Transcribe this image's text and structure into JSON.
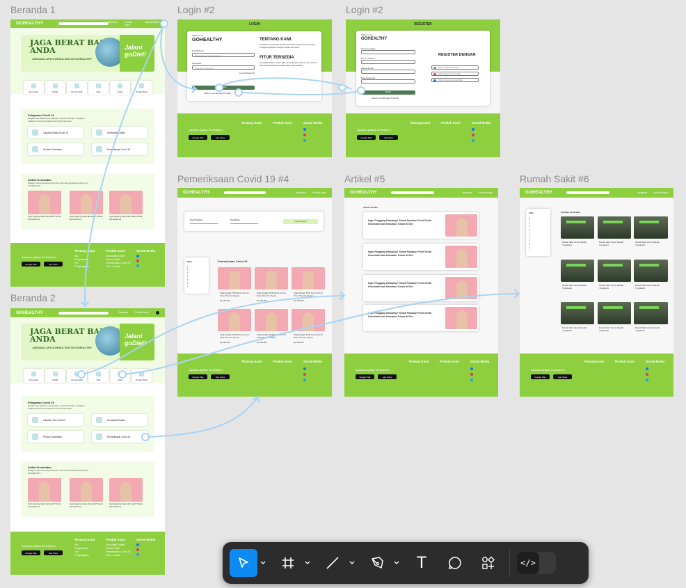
{
  "canvas": {
    "background": "#e5e5e5",
    "accent": "#8dcf3f",
    "selection": "#0d8bf2",
    "connector": "#a9d3f5"
  },
  "frames": {
    "beranda1": "Beranda 1",
    "beranda2": "Beranda 2",
    "login": "Login #2",
    "register": "Login #2",
    "covid": "Pemeriksaan Covid 19 #4",
    "artikel": "Artikel #5",
    "rumahsakit": "Rumah Sakit #6"
  },
  "nav": {
    "logo": "GOHEALTHY",
    "links": [
      "Beranda",
      "Kontak Kami",
      "Masuk/Daftar"
    ],
    "links2": [
      "Beranda",
      "Produk Kami"
    ]
  },
  "hero": {
    "title_line1": "JAGA BERAT BADAN",
    "title_line2": "ANDA",
    "subtitle": "JANGAN LUPA KONSULTASI DI GOHEALTHY",
    "cta_line1": "Jalani",
    "cta_line2": "goDiet!"
  },
  "categories": [
    "Konsultasi",
    "Mobile",
    "Rumah Sakit",
    "Toko",
    "Artikel",
    "Produk Medis"
  ],
  "covid_section": {
    "title": "Pelayanan Covid 19",
    "desc": "Jangan lupa lakukan pencegahan covid-19 dengan mengikuti kebijakan dari Kemenkes/pemerintah setempat.",
    "services": [
      "Lakukan Rapid Covid 19",
      "Konsultasi Dokter",
      "Produk Kesehatan",
      "Pemeriksaan Covid 19"
    ],
    "services2": [
      "Lakukan Tes Covid 19",
      "Konsultasi Dokter",
      "Produk Kesehatan",
      "Pemeriksaan Covid 19"
    ]
  },
  "articles": {
    "title": "Artikel Kesehatan",
    "desc": "Pelajari cara pola hidup sehat dan informasi kesehatan lainnya di GOHEALTHY.",
    "item": "Ingin langsing tanpa diet ketat? Simak tips berikut ini"
  },
  "footer": {
    "download": "Dapatkan Aplikasi GoHealthy di",
    "google_play": "Google Play",
    "app_store": "App Store",
    "col1_title": "Tentang Kami",
    "col1": [
      "Visi",
      "Pengalaman",
      "Tim",
      "Penghargaan"
    ],
    "col2_title": "Produk Kami",
    "col2": [
      "Konsultasi Dokter",
      "Rumah Sakit",
      "Pemeriksaan Covid-19",
      "Toko - Apotek"
    ],
    "col3_title": "Social Media",
    "col3": [
      "Facebook",
      "Instagram",
      "Twitter"
    ]
  },
  "login": {
    "header": "LOGIN",
    "welcome": "Welcome to",
    "brand": "GOHEALTHY",
    "email_label": "Email/Nomor",
    "email_placeholder": "Masukkan email atau nomor",
    "password_label": "Password",
    "password_placeholder": "Masukkan password",
    "forgot": "Lupa Password?",
    "button": "Masuk",
    "register_prompt": "Belum memiliki akun? Daftar",
    "about_title": "TENTANG KAMI",
    "about_text": "GoHealthy merupakan aplikasi kesehatan yang membantu Anda menjaga kesehatan dengan mudah dan cepat.",
    "features_title": "FITUR TERSEDIA",
    "features_text": "Konsultasi dokter, rumah sakit, pemeriksaan covid-19, toko apotek dan artikel kesehatan tersedia dalam satu aplikasi."
  },
  "register": {
    "header": "REGISTER",
    "welcome": "Welcome to",
    "brand": "GOHEALTHY",
    "fields": [
      "Nama Lengkap",
      "Nomor Telepon",
      "Alamat Email",
      "Buat Password"
    ],
    "button": "Daftar",
    "login_prompt": "Sudah memiliki akun? Masuk",
    "side_title": "REGISTER DENGAN",
    "options": [
      "Daftar dengan akun Apple",
      "Daftar dengan akun Google",
      "Daftar dengan akun Facebook"
    ]
  },
  "covid_page": {
    "search1": "Cari Provinsi",
    "search2": "Cari Kota",
    "search_button": "Cari Provinsi",
    "filter_title": "Filter",
    "section_title": "Pemeriksaan Covid 19",
    "item": "Swab Antigen PCR Test Covid 19 Drive-Thru (1x 24 jam)",
    "price": "Rp 150.000"
  },
  "artikel_page": {
    "title": "Artikel Terbaru",
    "items": [
      "Ingin Pinggang Ramping? Simak Panduan Perut Sehat Kesehatan dan Kekuatan Tubuh di Sini",
      "Ingin Pinggang Ramping? Simak Panduan Perut Sehat Kesehatan dan Kekuatan Tubuh di Sini",
      "Ingin Pinggang Ramping? Simak Panduan Perut Sehat Kesehatan dan Kekuatan Tubuh di Sini",
      "Ingin Pinggang Ramping? Simak Panduan Perut Sehat Kesehatan dan Kekuatan Tubuh di Sini"
    ]
  },
  "rs_page": {
    "filter_title": "Filter",
    "section_title": "Fasilitas Kesehatan",
    "item": "Rumah Sakit Umum Daerah Yogyakarta"
  },
  "toolbar": {
    "tools": [
      "move-tool",
      "frame-tool",
      "line-tool",
      "pen-tool",
      "text-tool",
      "comment-tool",
      "components-tool"
    ],
    "text_glyph": "T",
    "code_glyph": "</>"
  }
}
